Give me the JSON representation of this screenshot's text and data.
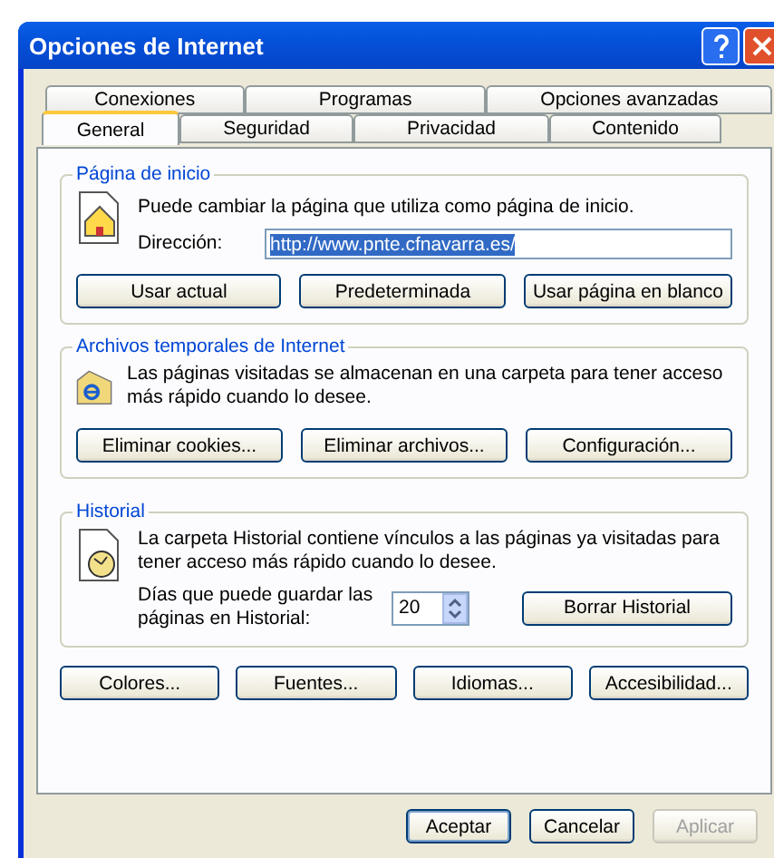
{
  "window": {
    "title": "Opciones de Internet"
  },
  "tab_rows": [
    [
      {
        "label": "Conexiones",
        "selected": false
      },
      {
        "label": "Programas",
        "selected": false
      },
      {
        "label": "Opciones avanzadas",
        "selected": false
      }
    ],
    [
      {
        "label": "General",
        "selected": true
      },
      {
        "label": "Seguridad",
        "selected": false
      },
      {
        "label": "Privacidad",
        "selected": false
      },
      {
        "label": "Contenido",
        "selected": false
      }
    ]
  ],
  "home_page": {
    "legend": "Página de inicio",
    "text": "Puede cambiar la página que utiliza como página de inicio.",
    "address_label": "Dirección:",
    "address": "http://www.pnte.cfnavarra.es/",
    "buttons": [
      "Usar actual",
      "Predeterminada",
      "Usar página en blanco"
    ]
  },
  "temp_files": {
    "legend": "Archivos temporales de Internet",
    "text": "Las páginas visitadas se almacenan en una carpeta para tener acceso más rápido cuando lo desee.",
    "buttons": [
      "Eliminar cookies...",
      "Eliminar archivos...",
      "Configuración..."
    ]
  },
  "history": {
    "legend": "Historial",
    "text": "La carpeta Historial contiene vínculos a las páginas ya visitadas para tener acceso más rápido cuando lo desee.",
    "days_label": "Días que puede guardar las páginas en Historial:",
    "days": "20",
    "clear_button": "Borrar Historial"
  },
  "bottom_buttons": [
    "Colores...",
    "Fuentes...",
    "Idiomas...",
    "Accesibilidad..."
  ],
  "dialog_buttons": [
    {
      "label": "Aceptar",
      "disabled": false,
      "default": true
    },
    {
      "label": "Cancelar",
      "disabled": false,
      "default": false
    },
    {
      "label": "Aplicar",
      "disabled": true,
      "default": false
    }
  ]
}
